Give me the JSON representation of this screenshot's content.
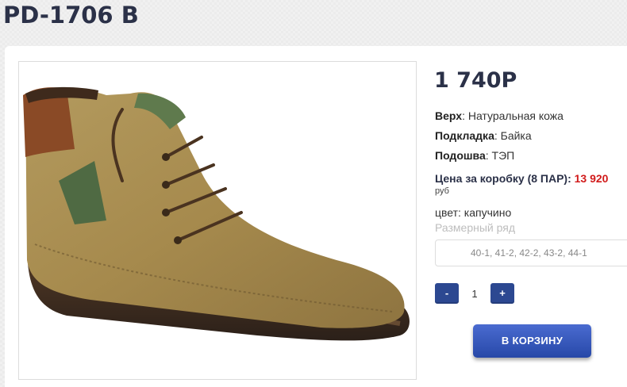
{
  "product": {
    "title": "PD-1706 B",
    "price": "1 740Р"
  },
  "specs": {
    "upper_label": "Верх",
    "upper_value": ": Натуральная кожа",
    "lining_label": "Подкладка",
    "lining_value": ": Байка",
    "sole_label": "Подошва",
    "sole_value": ": ТЭП"
  },
  "box": {
    "label": "Цена за коробку (8 ПАР):",
    "amount": "13 920",
    "currency": "руб"
  },
  "color": {
    "text": "цвет: капучино"
  },
  "sizes": {
    "label": "Размерный ряд",
    "value": "40-1, 41-2, 42-2, 43-2, 44-1"
  },
  "quantity": {
    "minus": "-",
    "value": "1",
    "plus": "+"
  },
  "cart": {
    "button_label": "В КОРЗИНУ"
  },
  "colors": {
    "title": "#2b3148",
    "accent_red": "#d11a1a",
    "button_blue": "#2c4891"
  },
  "image": {
    "icon": "boot-photo"
  }
}
